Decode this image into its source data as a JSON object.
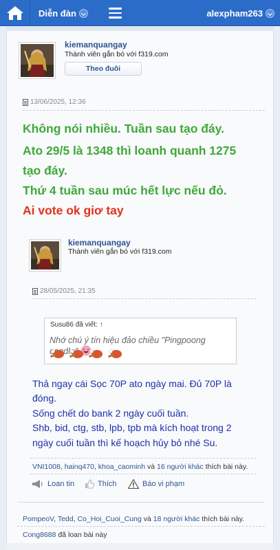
{
  "topbar": {
    "forum_label": "Diễn đàn",
    "username": "alexpham263"
  },
  "post": {
    "author": "kiemanquangay",
    "author_title": "Thành viên gắn bó với f319.com",
    "follow_label": "Theo đuôi",
    "date": "13/06/2025, 12:36",
    "lines_green": [
      "Không nói nhiều. Tuần sau tạo đáy.",
      "Ato 29/5 là 1348 thì loanh quanh 1275",
      "tạo đáy.",
      "Thứ 4 tuần sau múc hết lực nếu đỏ."
    ],
    "line_red": "Ai vote ok giơ tay",
    "likes": {
      "names": [
        "PompeoV",
        "Tedd",
        "Co_Hoi_Cuoi_Cung"
      ],
      "connector": "và",
      "others": "18 người khác",
      "suffix": "thích bài này."
    },
    "shared_by": "Cong8688",
    "shared_suffix": "đã loan bài này"
  },
  "quoted_post": {
    "author": "kiemanquangay",
    "author_title": "Thành viên gắn bó với f319.com",
    "date": "28/05/2025, 21:35",
    "quote": {
      "header": "Susu86 đã viết: ↑",
      "text": "Nhớ chú ý tín hiệu đảo chiều \"Pingpoong candle\""
    },
    "text_lines": [
      "Thả ngay cái Sọc 70P ato ngày mai. Đủ 70P là",
      "đóng.",
      "Sống chết do bank 2 ngày cuối tuần.",
      "Shb, bid, ctg, stb, lpb, tpb mà kích hoạt trong 2",
      "ngày cuối tuần thì kế hoạch hủy bỏ nhé Su."
    ],
    "likes": {
      "names": [
        "VNI1008",
        "hainq470",
        "khoa_caominh"
      ],
      "connector": "và",
      "others": "16 người khác",
      "suffix": "thích bài này."
    },
    "actions": {
      "share": "Loan tin",
      "like": "Thích",
      "report": "Báo vi phạm"
    }
  },
  "colors": {
    "topbar": "#2b6cc9",
    "green_text": "#3fa83a",
    "red_text": "#e0321c",
    "blue_text": "#1c2fa8",
    "link": "#2c5491"
  }
}
